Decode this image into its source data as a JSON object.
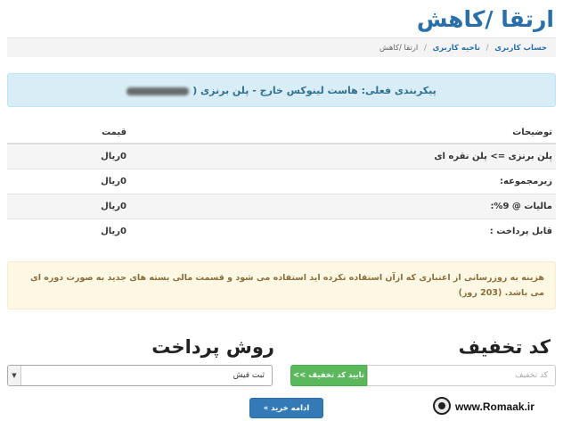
{
  "page": {
    "title": "ارتقا /کاهش"
  },
  "breadcrumb": {
    "items": [
      "حساب کاربری",
      "ناحیه کاربری",
      "ارتقا /کاهش"
    ]
  },
  "info": {
    "text": "پیکربندی فعلی: هاست لینوکس خارج - پلن برنزی ("
  },
  "table": {
    "headers": {
      "description": "توضیحات",
      "price": "قیمت"
    },
    "rows": [
      {
        "label": "پلن برنزی => پلن نقره ای",
        "price": "0ریال"
      },
      {
        "label": "زیرمجموعه:",
        "price": "0ریال"
      },
      {
        "label": "مالیات @ 9%:",
        "price": "0ریال"
      },
      {
        "label": "قابل پرداخت :",
        "price": "0ریال"
      }
    ]
  },
  "warning": {
    "text": "هزینه به روزرسانی از اعتباری که ازآن استفاده نکرده اید استفاده می شود و قسمت مالی بسته های جدید به صورت دوره ای می باشد. (203 روز)"
  },
  "discount": {
    "title": "کد تخفیف",
    "placeholder": "کد تخفیف",
    "value": "",
    "button_label": "تایید کد تخفیف >>"
  },
  "payment": {
    "title": "روش پرداخت",
    "selected": "ثبت فیش"
  },
  "actions": {
    "continue_label": "ادامه خرید »"
  },
  "watermark": {
    "text": "www.Romaak.ir"
  },
  "colors": {
    "title": "#2a6fa8",
    "info_bg": "#d9edf7",
    "warning_bg": "#fcf8e3",
    "success": "#5cb85c",
    "primary": "#337ab7"
  }
}
